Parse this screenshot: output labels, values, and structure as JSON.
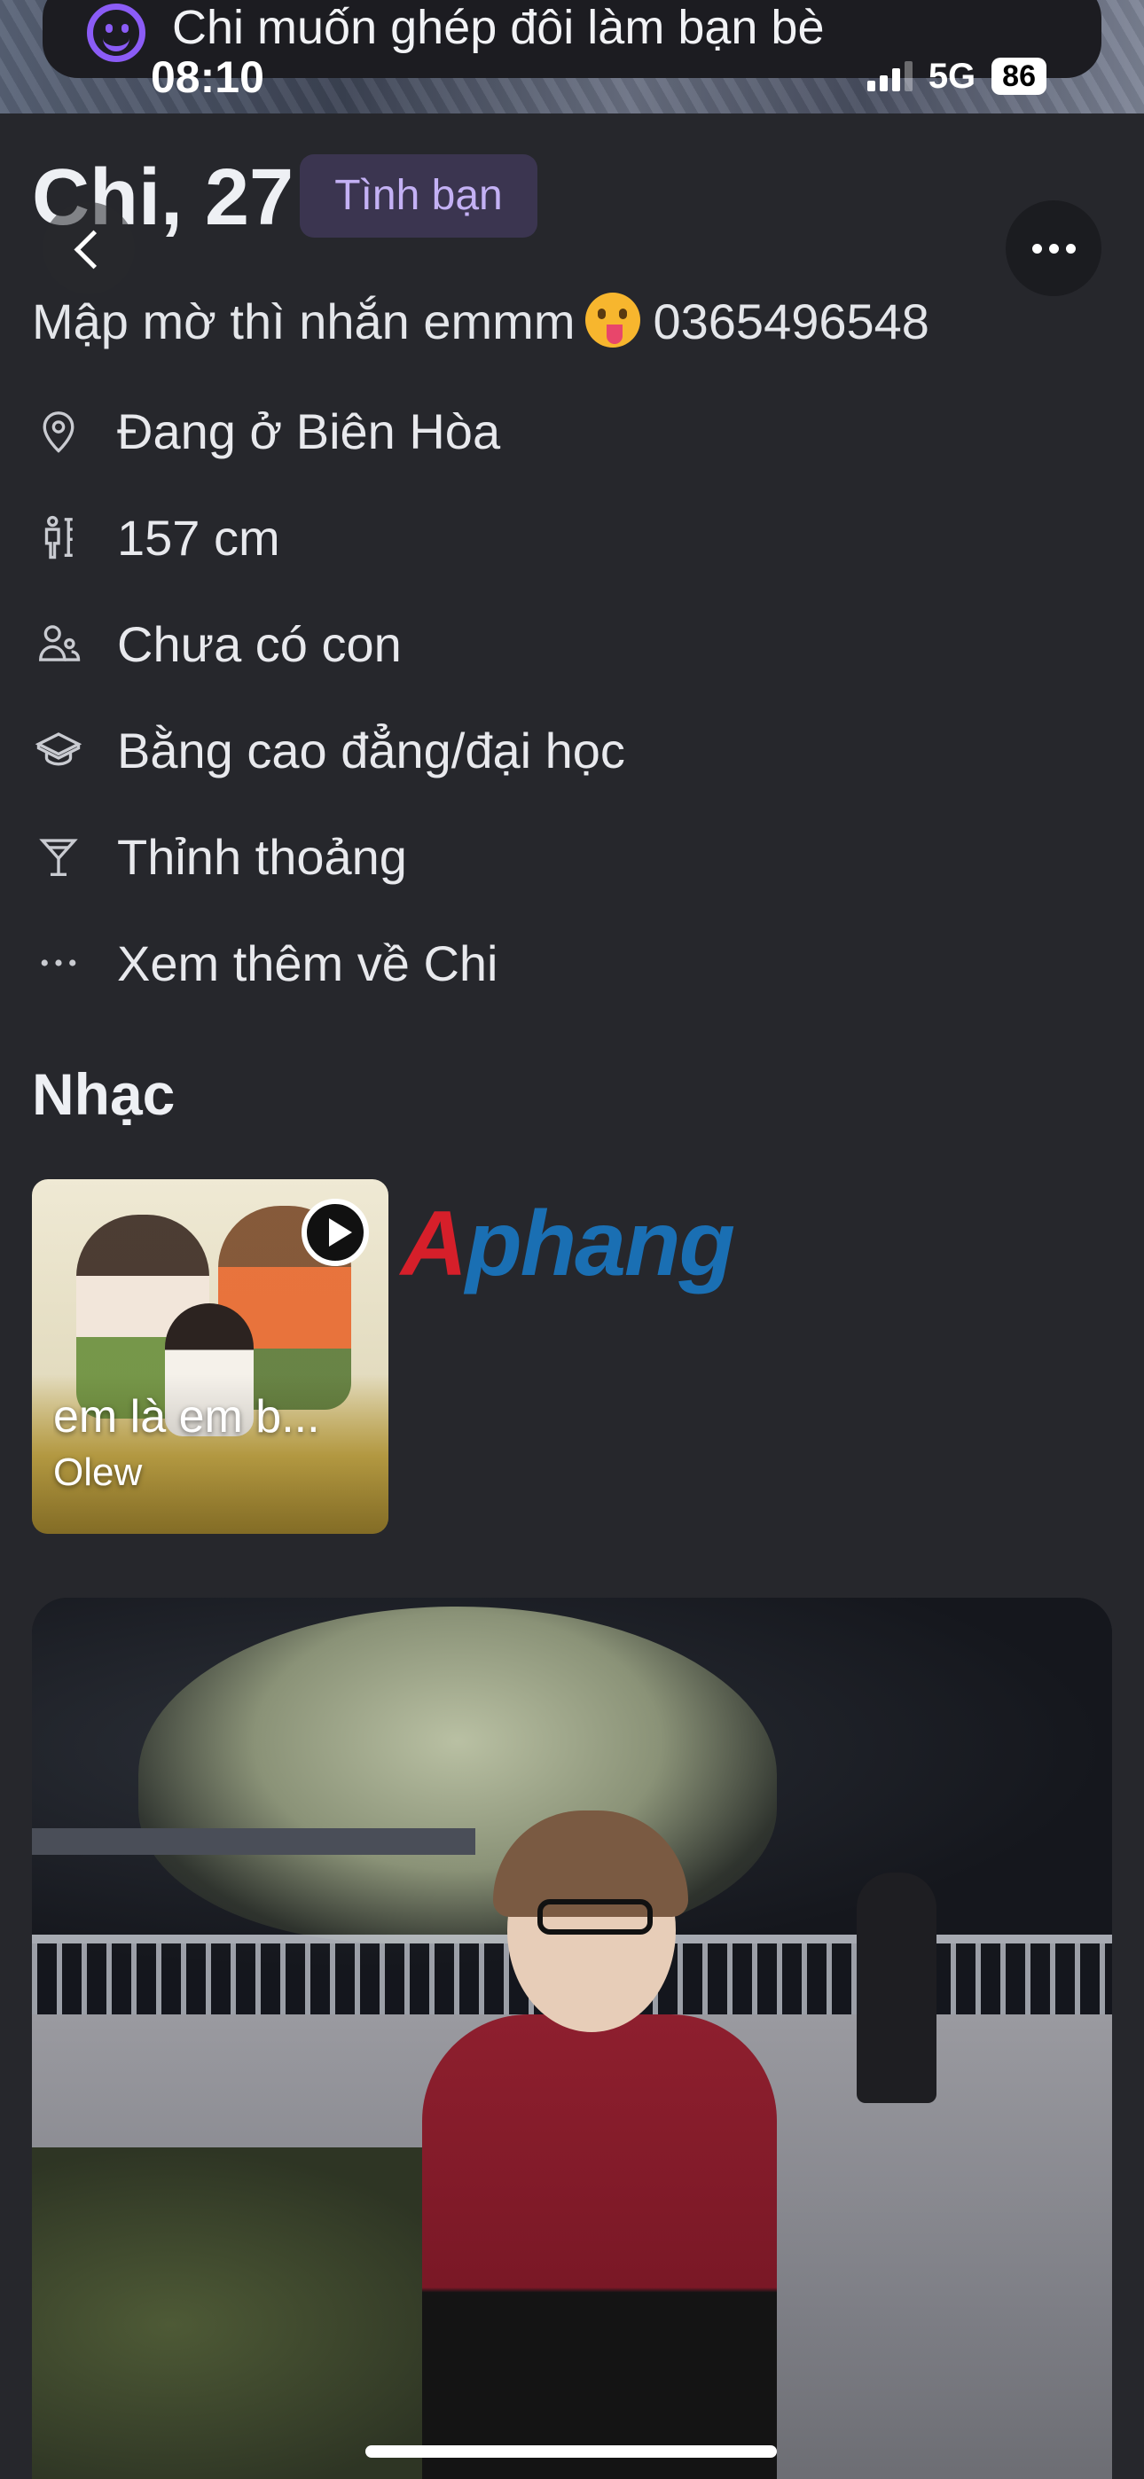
{
  "status_bar": {
    "time": "08:10",
    "network": "5G",
    "battery": "86"
  },
  "banner": {
    "text": "Chi muốn ghép đôi làm bạn bè",
    "icon": "smiley-icon"
  },
  "profile": {
    "name_age": "Chi, 27",
    "badge": "Tình bạn",
    "bio_prefix": "Mập mờ thì nhắn emmm",
    "bio_suffix": "0365496548",
    "bio_emoji": "tongue-out-emoji"
  },
  "details": [
    {
      "icon": "location-pin-icon",
      "text": "Đang ở Biên Hòa"
    },
    {
      "icon": "height-icon",
      "text": "157 cm"
    },
    {
      "icon": "children-icon",
      "text": "Chưa có con"
    },
    {
      "icon": "education-icon",
      "text": "Bằng cao đẳng/đại học"
    },
    {
      "icon": "drink-icon",
      "text": "Thỉnh thoảng"
    },
    {
      "icon": "more-dots-icon",
      "text": "Xem thêm về Chi"
    }
  ],
  "music": {
    "section_title": "Nhạc",
    "song_title": "em là em b...",
    "artist": "Olew"
  },
  "watermark": "Aphang",
  "colors": {
    "background": "#26272c",
    "badge_bg": "#3b3550",
    "badge_text": "#c4b1f5",
    "accent": "#8b5cf6"
  }
}
